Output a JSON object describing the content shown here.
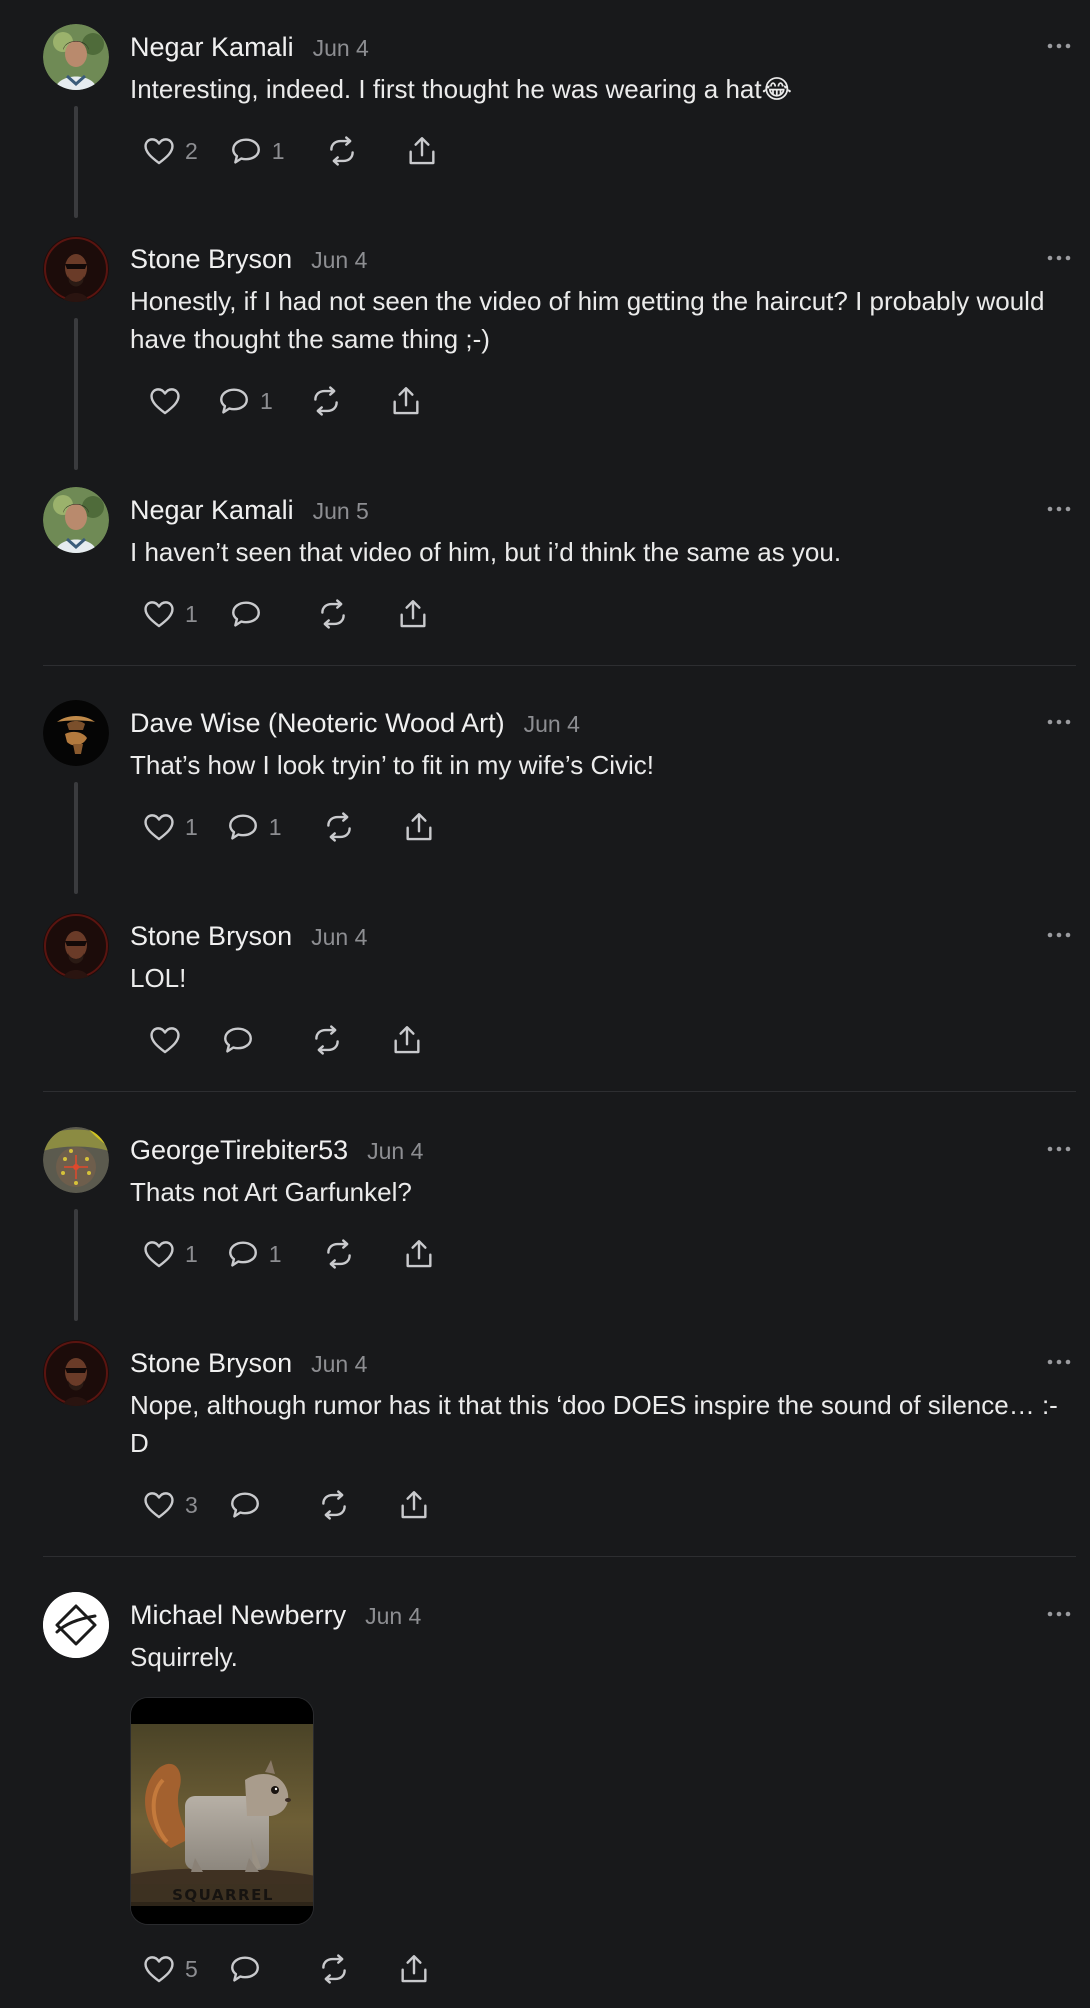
{
  "comments": [
    {
      "author": "Negar Kamali",
      "date": "Jun 4",
      "text": "Interesting, indeed. I first thought he was wearing a hat😂",
      "likes": "2",
      "replies": "1"
    },
    {
      "author": "Stone Bryson",
      "date": "Jun 4",
      "text": "Honestly, if I had not seen the video of him getting the haircut? I probably would have thought the same thing ;-)",
      "likes": "",
      "replies": "1"
    },
    {
      "author": "Negar Kamali",
      "date": "Jun 5",
      "text": "I haven’t seen that video of him, but i’d think the same as you.",
      "likes": "1",
      "replies": ""
    },
    {
      "author": "Dave Wise (Neoteric Wood Art)",
      "date": "Jun 4",
      "text": "That’s how I look tryin’ to fit in my wife’s Civic!",
      "likes": "1",
      "replies": "1"
    },
    {
      "author": "Stone Bryson",
      "date": "Jun 4",
      "text": "LOL!",
      "likes": "",
      "replies": ""
    },
    {
      "author": "GeorgeTirebiter53",
      "date": "Jun 4",
      "text": "Thats not Art Garfunkel?",
      "likes": "1",
      "replies": "1"
    },
    {
      "author": "Stone Bryson",
      "date": "Jun 4",
      "text": "Nope, although rumor has it that this ‘doo DOES inspire the sound of silence… :-D",
      "likes": "3",
      "replies": ""
    },
    {
      "author": "Michael Newberry",
      "date": "Jun 4",
      "text": "Squirrely.",
      "likes": "5",
      "replies": "",
      "image_caption": "SQUARREL"
    }
  ],
  "icons": {
    "like": "heart-icon",
    "reply": "speech-bubble-icon",
    "repost": "repost-icon",
    "share": "share-icon",
    "more": "more-dots-icon"
  },
  "colors": {
    "background": "#18191b",
    "text": "#ebebeb",
    "muted": "#8d8e92",
    "thread_line": "#3a3b3e"
  }
}
